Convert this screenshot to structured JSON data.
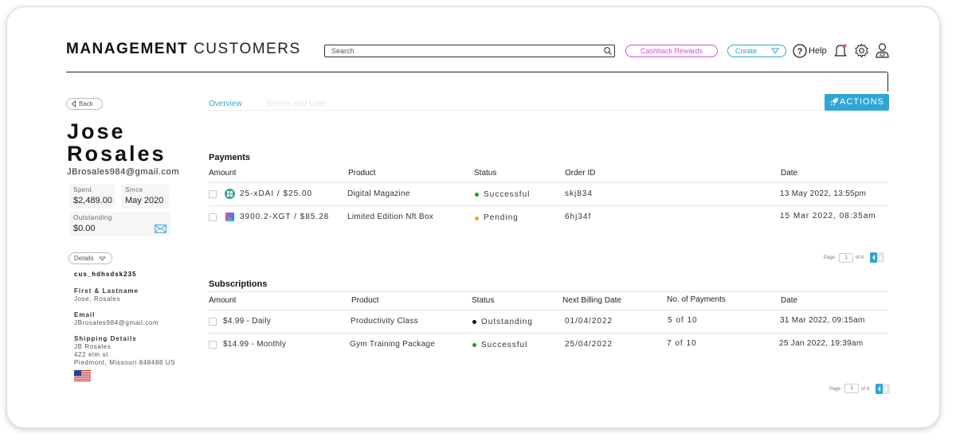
{
  "header": {
    "brand_bold": "MANAGEMENT",
    "brand_light": "CUSTOMERS",
    "search_placeholder": "Search",
    "cashback_label": "Cashback Rewards",
    "create_label": "Create",
    "help_label": "Help"
  },
  "nav": {
    "back_label": "Back"
  },
  "customer": {
    "first_name": "Jose",
    "last_name": "Rosales",
    "email": "JBrosales984@gmail.com",
    "spent_label": "Spent",
    "spent_value": "$2,489.00",
    "since_label": "Since",
    "since_value": "May 2020",
    "outstanding_label": "Outstanding",
    "outstanding_value": "$0.00",
    "details_label": "Details",
    "customer_id": "cus_hdhsdsk235",
    "fullname_label": "First & Lastname",
    "fullname_value": "Jose, Rosales",
    "email_label": "Email",
    "email_value": "JBrosales984@gmail.com",
    "shipping_label": "Shipping Details",
    "shipping_name": "JB Rosales",
    "shipping_street": "422 elm st",
    "shipping_city": "Piedmont, Missouri 848488 US",
    "flag_icon": "us-flag-icon"
  },
  "tabs": {
    "overview": "Overview",
    "events": "Events and Logs"
  },
  "actions_label": "ACTIONS",
  "payments": {
    "title": "Payments",
    "columns": [
      "Amount",
      "Product",
      "Status",
      "Order ID",
      "Date"
    ],
    "rows": [
      {
        "amount": "25-xDAI / $25.00",
        "product": "Digital Magazine",
        "status": "Successful",
        "status_color": "#1aa31a",
        "order_id": "skj834",
        "date": "13 May 2022, 13:55pm",
        "coin_icon": "xdai-coin-icon"
      },
      {
        "amount": "3900.2-XGT / $85.28",
        "product": "Limited Edition Nft Box",
        "status": "Pending",
        "status_color": "#f0a02a",
        "order_id": "6hj34f",
        "date": "15 Mar 2022, 08:35am",
        "coin_icon": "xgt-coin-icon"
      }
    ],
    "pager": {
      "page_label": "Page",
      "page_value": "1",
      "of_label": "of 4"
    }
  },
  "subscriptions": {
    "title": "Subscriptions",
    "columns": [
      "Amount",
      "Product",
      "Status",
      "Next Billing Date",
      "No. of Payments",
      "Date"
    ],
    "rows": [
      {
        "amount": "$4.99 - Daily",
        "product": "Productivity Class",
        "status": "Outstanding",
        "status_color": "#111111",
        "next_billing": "01/04/2022",
        "payments": "5 of 10",
        "date": "31 Mar 2022, 09:15am"
      },
      {
        "amount": "$14.99 - Monthly",
        "product": "Gym Training Package",
        "status": "Successful",
        "status_color": "#1aa31a",
        "next_billing": "25/04/2022",
        "payments": "7 of 10",
        "date": "25 Jan 2022, 19:39am"
      }
    ],
    "pager": {
      "page_label": "Page",
      "page_value": "1",
      "of_label": "of 4"
    }
  },
  "colors": {
    "accent": "#2fa6d6",
    "cashback": "#d24fd6"
  }
}
